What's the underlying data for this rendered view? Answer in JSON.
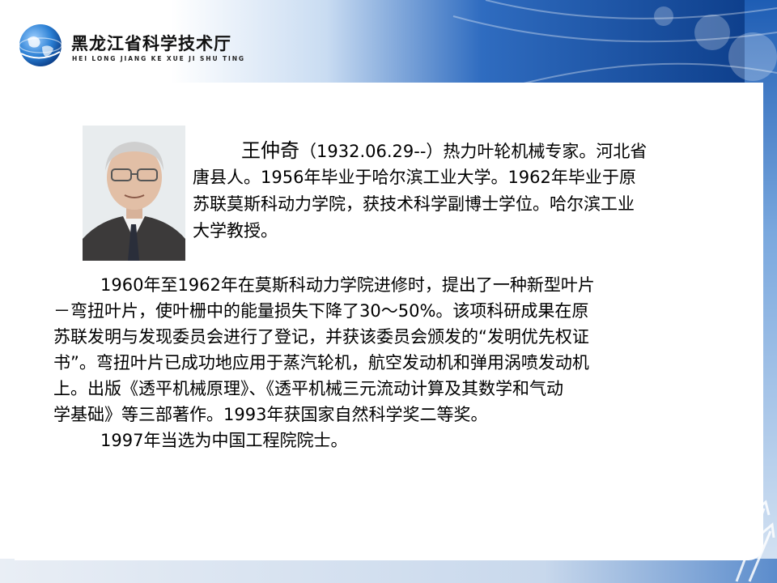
{
  "header": {
    "org_name": "黑龙江省科学技术厅",
    "org_pinyin": "HEI LONG JIANG KE XUE JI SHU TING"
  },
  "profile": {
    "name": "王仲奇",
    "intro_lines": [
      "（1932.06.29--）热力叶轮机械专家。河北省",
      "唐县人。1956年毕业于哈尔滨工业大学。1962年毕业于原",
      "苏联莫斯科动力学院，获技术科学副博士学位。哈尔滨工业",
      "大学教授。"
    ]
  },
  "body": {
    "lines": [
      "1960年至1962年在莫斯科动力学院进修时，提出了一种新型叶片",
      "－弯扭叶片，使叶栅中的能量损失下降了30～50%。该项科研成果在原",
      "苏联发明与发现委员会进行了登记，并获该委员会颁发的“发明优先权证",
      "书”。弯扭叶片已成功地应用于蒸汽轮机，航空发动机和弹用涡喷发动机",
      "上。出版《透平机械原理》、《透平机械三元流动计算及其数学和气动",
      "学基础》等三部著作。1993年获国家自然科学奖二等奖。",
      "1997年当选为中国工程院院士。"
    ]
  },
  "colors": {
    "header_blue_dark": "#0d3f8c",
    "header_blue_light": "#5f95d6",
    "text": "#000000"
  }
}
